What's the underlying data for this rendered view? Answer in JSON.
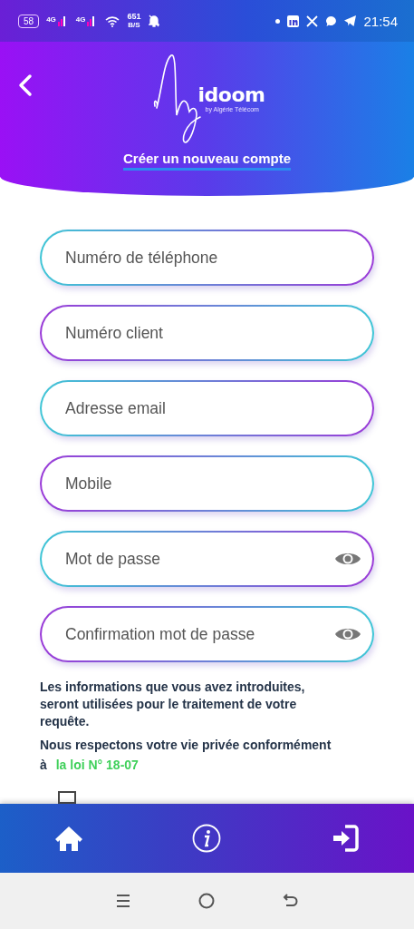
{
  "status_bar": {
    "battery": "58",
    "network_1": "4G",
    "network_2": "4G",
    "speed": "651",
    "speed_unit": "B/S",
    "time": "21:54"
  },
  "header": {
    "logo": "idoom",
    "logo_tagline": "by Algérie Télécom",
    "title": "Créer un nouveau compte"
  },
  "fields": [
    {
      "placeholder": "Numéro de téléphone",
      "kind": "text"
    },
    {
      "placeholder": "Numéro client",
      "kind": "text"
    },
    {
      "placeholder": "Adresse email",
      "kind": "text"
    },
    {
      "placeholder": "Mobile",
      "kind": "text"
    },
    {
      "placeholder": "Mot de passe",
      "kind": "password"
    },
    {
      "placeholder": "Confirmation mot de passe",
      "kind": "password"
    }
  ],
  "notice": "Les informations que vous avez introduites, seront utilisées pour le traitement de votre requête.",
  "privacy": {
    "text": "Nous respectons votre vie privée conformément à",
    "link": "la loi N° 18-07"
  },
  "consent": {
    "checked": false
  }
}
